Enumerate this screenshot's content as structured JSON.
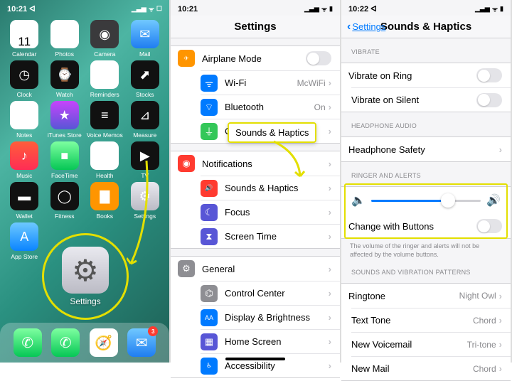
{
  "phone1": {
    "time": "10:21 ᐊ",
    "date_day": "TUE",
    "date_num": "11",
    "apps": [
      {
        "name": "Calendar",
        "icon": "cal"
      },
      {
        "name": "Photos",
        "icon": "photos"
      },
      {
        "name": "Camera",
        "icon": "camera"
      },
      {
        "name": "Mail",
        "icon": "mail"
      },
      {
        "name": "Clock",
        "icon": "clock"
      },
      {
        "name": "Watch",
        "icon": "watch"
      },
      {
        "name": "Reminders",
        "icon": "reminders"
      },
      {
        "name": "Stocks",
        "icon": "stocks"
      },
      {
        "name": "Notes",
        "icon": "notes"
      },
      {
        "name": "iTunes Store",
        "icon": "itunes"
      },
      {
        "name": "Voice Memos",
        "icon": "voice"
      },
      {
        "name": "Measure",
        "icon": "measure"
      },
      {
        "name": "Music",
        "icon": "music"
      },
      {
        "name": "FaceTime",
        "icon": "facetime"
      },
      {
        "name": "Health",
        "icon": "health"
      },
      {
        "name": "TV",
        "icon": "tv"
      },
      {
        "name": "Wallet",
        "icon": "wallet"
      },
      {
        "name": "Fitness",
        "icon": "fitness"
      },
      {
        "name": "Books",
        "icon": "books"
      },
      {
        "name": "Settings",
        "icon": "settings"
      },
      {
        "name": "App Store",
        "icon": "appstore"
      },
      {
        "name": "",
        "icon": ""
      },
      {
        "name": "",
        "icon": ""
      },
      {
        "name": "",
        "icon": ""
      }
    ],
    "focus_label": "Settings",
    "mail_badge": "3"
  },
  "phone2": {
    "time": "10:21",
    "title": "Settings",
    "callout": "Sounds & Haptics",
    "groups": [
      [
        {
          "icon": "✈︎",
          "color": "c-orange",
          "label": "Airplane Mode",
          "acc": "toggle"
        },
        {
          "icon": "ᯤ",
          "color": "c-blue",
          "label": "Wi-Fi",
          "value": "McWiFi",
          "acc": "chev"
        },
        {
          "icon": "⌔",
          "color": "c-blue",
          "label": "Bluetooth",
          "value": "On",
          "acc": "chev"
        },
        {
          "icon": "⏚",
          "color": "c-green",
          "label": "Cellular",
          "acc": "chev"
        }
      ],
      [
        {
          "icon": "◉",
          "color": "c-red",
          "label": "Notifications",
          "acc": "chev"
        },
        {
          "icon": "🔊",
          "color": "c-red",
          "label": "Sounds & Haptics",
          "acc": "chev"
        },
        {
          "icon": "☾",
          "color": "c-indigo",
          "label": "Focus",
          "acc": "chev"
        },
        {
          "icon": "⧗",
          "color": "c-indigo",
          "label": "Screen Time",
          "acc": "chev"
        }
      ],
      [
        {
          "icon": "⚙",
          "color": "c-gray",
          "label": "General",
          "acc": "chev"
        },
        {
          "icon": "⌬",
          "color": "c-gray",
          "label": "Control Center",
          "acc": "chev"
        },
        {
          "icon": "AA",
          "color": "c-blue",
          "label": "Display & Brightness",
          "acc": "chev"
        },
        {
          "icon": "▦",
          "color": "c-indigo",
          "label": "Home Screen",
          "acc": "chev"
        },
        {
          "icon": "♿︎",
          "color": "c-blue",
          "label": "Accessibility",
          "acc": "chev"
        }
      ]
    ]
  },
  "phone3": {
    "time": "10:22 ᐊ",
    "back": "Settings",
    "title": "Sounds & Haptics",
    "vibrate_header": "VIBRATE",
    "rows_vibrate": [
      {
        "label": "Vibrate on Ring"
      },
      {
        "label": "Vibrate on Silent"
      }
    ],
    "headphone_header": "HEADPHONE AUDIO",
    "headphone_row": "Headphone Safety",
    "ringer_header": "RINGER AND ALERTS",
    "change_buttons": "Change with Buttons",
    "footnote": "The volume of the ringer and alerts will not be affected by the volume buttons.",
    "sounds_header": "SOUNDS AND VIBRATION PATTERNS",
    "sound_rows": [
      {
        "label": "Ringtone",
        "value": "Night Owl"
      },
      {
        "label": "Text Tone",
        "value": "Chord"
      },
      {
        "label": "New Voicemail",
        "value": "Tri-tone"
      },
      {
        "label": "New Mail",
        "value": "Chord"
      }
    ]
  }
}
